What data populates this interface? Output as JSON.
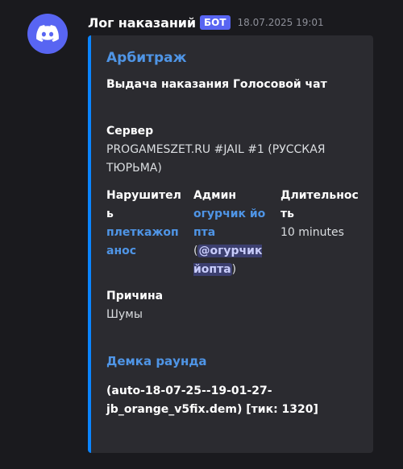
{
  "message": {
    "username": "Лог наказаний",
    "bot_badge": "БОТ",
    "timestamp": "18.07.2025 19:01",
    "avatar_icon": "discord-logo-icon",
    "accent_color": "#0a84ff",
    "avatar_color": "#5865f2"
  },
  "embed": {
    "author": "Арбитраж",
    "title": "Выдача наказания Голосовой чат",
    "fields": {
      "server": {
        "name": "Сервер",
        "value": "PROGAMESZET.RU #JAIL #1 (РУССКАЯ ТЮРЬМА)"
      },
      "violator": {
        "name": "Нарушитель",
        "value": "плеткажопанос"
      },
      "admin": {
        "name": "Админ",
        "value": "огурчик йопта",
        "mention_open": "(",
        "mention": "@огурчик йопта",
        "mention_close": ")"
      },
      "duration": {
        "name": "Длительность",
        "value": "10 minutes"
      },
      "reason": {
        "name": "Причина",
        "value": "Шумы"
      }
    },
    "demo": {
      "link": "Демка раунда",
      "text": "(auto-18-07-25--19-01-27-jb_orange_v5fix.dem) [тик: 1320]"
    }
  }
}
